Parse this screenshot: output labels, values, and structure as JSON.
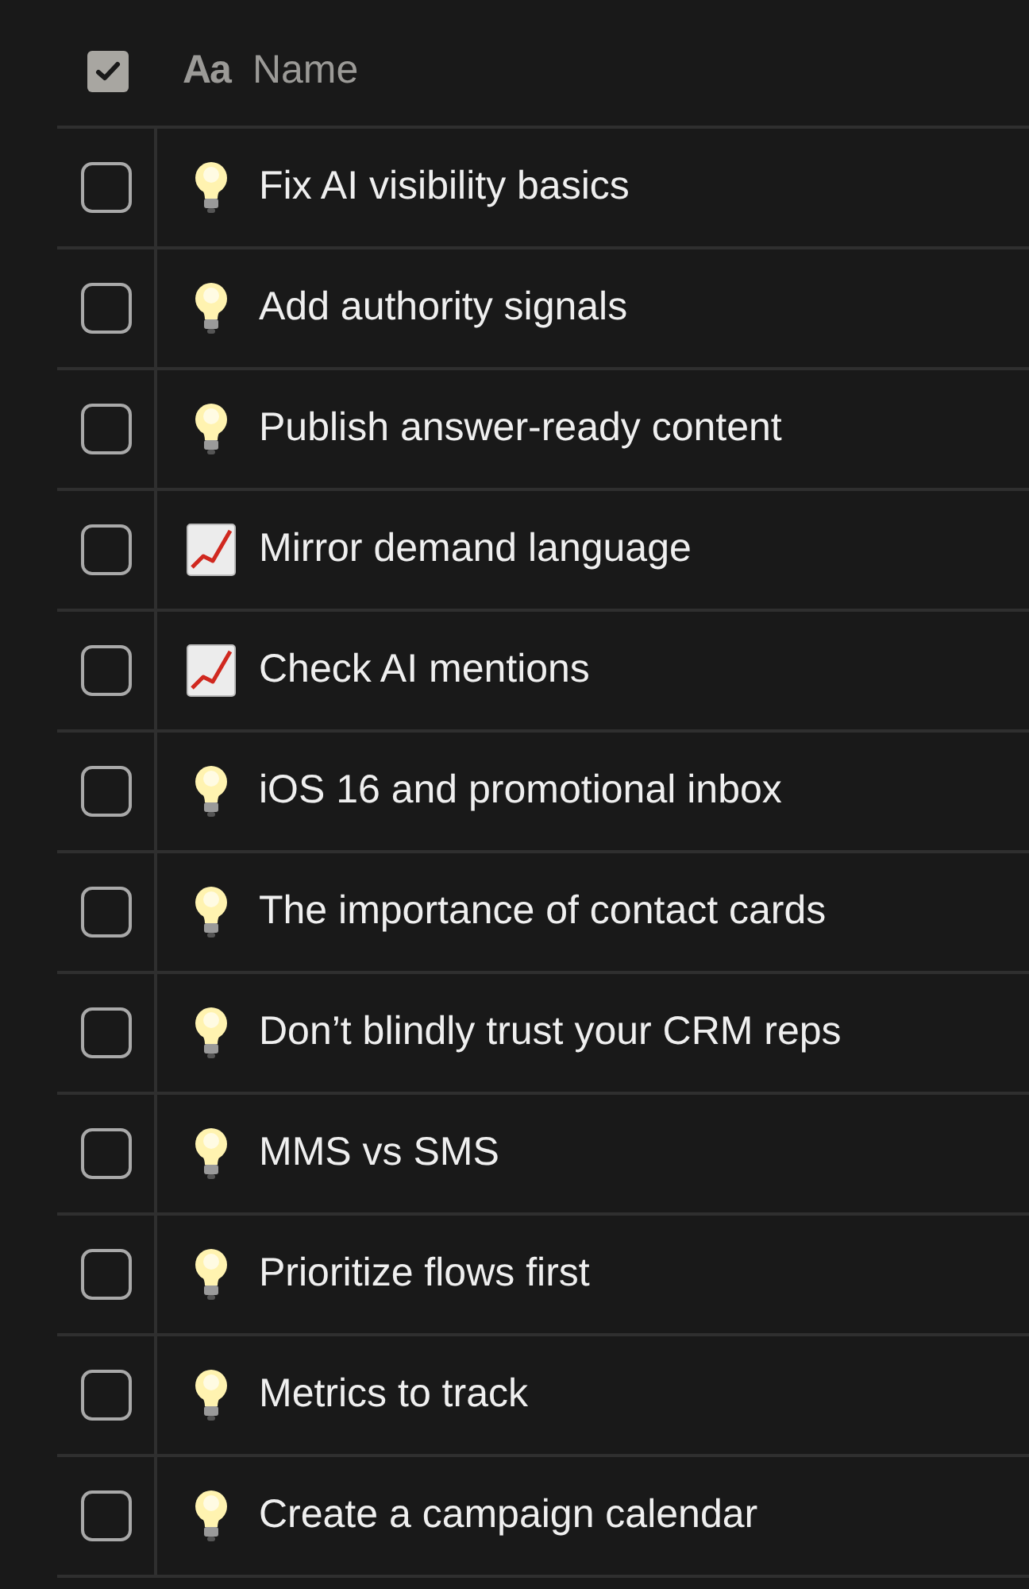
{
  "header": {
    "select_all": {
      "checked": true
    },
    "type_icon": "Aa",
    "label": "Name"
  },
  "rows": [
    {
      "kind": "bulb",
      "name": "Fix AI visibility basics",
      "checked": false
    },
    {
      "kind": "bulb",
      "name": "Add authority signals",
      "checked": false
    },
    {
      "kind": "bulb",
      "name": "Publish answer-ready content",
      "checked": false
    },
    {
      "kind": "chart",
      "name": "Mirror demand language",
      "checked": false
    },
    {
      "kind": "chart",
      "name": "Check AI mentions",
      "checked": false
    },
    {
      "kind": "bulb",
      "name": "iOS 16 and promotional inbox",
      "checked": false
    },
    {
      "kind": "bulb",
      "name": "The importance of contact cards",
      "checked": false
    },
    {
      "kind": "bulb",
      "name": "Don’t blindly trust your CRM reps",
      "checked": false
    },
    {
      "kind": "bulb",
      "name": "MMS vs SMS",
      "checked": false
    },
    {
      "kind": "bulb",
      "name": "Prioritize flows first",
      "checked": false
    },
    {
      "kind": "bulb",
      "name": "Metrics to track",
      "checked": false
    },
    {
      "kind": "bulb",
      "name": "Create a campaign calendar",
      "checked": false
    }
  ]
}
